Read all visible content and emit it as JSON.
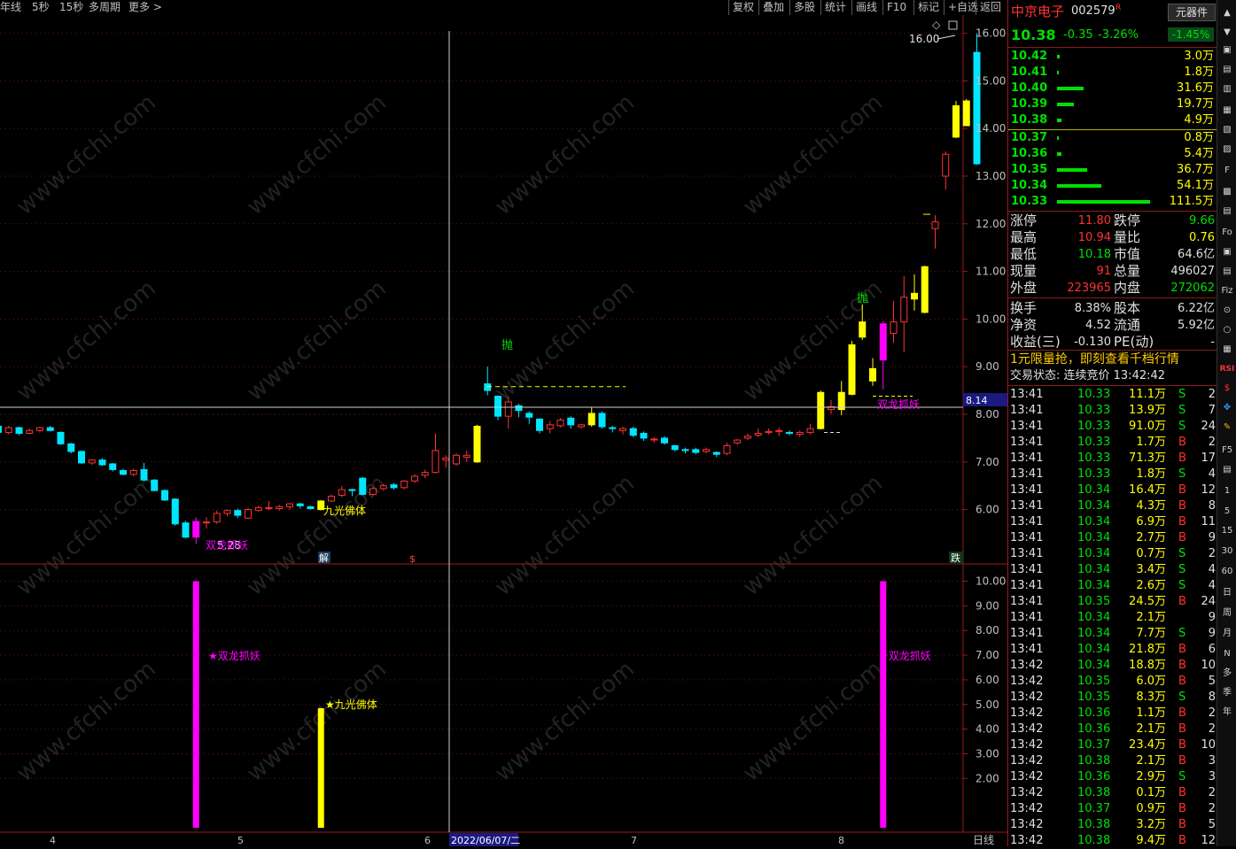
{
  "toolbar": {
    "left": [
      "年线",
      "5秒",
      "15秒",
      "多周期",
      "更多 >"
    ],
    "right": [
      "复权",
      "叠加",
      "多股",
      "统计",
      "画线",
      "F10",
      "标记",
      "+自选",
      "返回"
    ]
  },
  "watermark": "www.cfchi.com",
  "main_chart": {
    "y_ticks": [
      "16.00",
      "15.00",
      "14.00",
      "13.00",
      "12.00",
      "11.00",
      "10.00",
      "9.00",
      "8.00",
      "7.00",
      "6.00"
    ],
    "max_label": "16.00",
    "cursor_price": "8.14",
    "min_label": "5.28",
    "labels": {
      "sell_1": "抛",
      "sell_2": "抛",
      "double_dragon_1": "双龙抓妖",
      "double_dragon_2": "双龙抓妖",
      "nine_light": "九光佛体",
      "jie": "解",
      "s_mark": "$",
      "die": "跌"
    }
  },
  "sub_chart": {
    "y_ticks": [
      "10.00",
      "9.00",
      "8.00",
      "7.00",
      "6.00",
      "5.00",
      "4.00",
      "3.00",
      "2.00"
    ],
    "labels": {
      "double_dragon_1": "★双龙抓妖",
      "double_dragon_2": "★双龙抓妖",
      "nine_light": "★九光佛体"
    }
  },
  "date_axis": {
    "ticks": [
      "4",
      "5",
      "6",
      "7",
      "8"
    ],
    "cursor_date": "2022/06/07/二",
    "period": "日线"
  },
  "colors": {
    "up": "#ff3232",
    "down": "#00e5ff",
    "yellow": "#ffff00",
    "magenta": "#ff00ff",
    "green": "#00e000"
  },
  "quote": {
    "name": "中京电子",
    "code": "002579",
    "r_mark": "R",
    "sector": "元器件",
    "sector_change": "-1.45%",
    "price": "10.38",
    "change": "-0.35",
    "change_pct": "-3.26%",
    "asks": [
      {
        "price": "10.42",
        "vol": "3.0万",
        "bar": 3
      },
      {
        "price": "10.41",
        "vol": "1.8万",
        "bar": 2
      },
      {
        "price": "10.40",
        "vol": "31.6万",
        "bar": 30
      },
      {
        "price": "10.39",
        "vol": "19.7万",
        "bar": 19
      },
      {
        "price": "10.38",
        "vol": "4.9万",
        "bar": 5
      }
    ],
    "bids": [
      {
        "price": "10.37",
        "vol": "0.8万",
        "bar": 2
      },
      {
        "price": "10.36",
        "vol": "5.4万",
        "bar": 5
      },
      {
        "price": "10.35",
        "vol": "36.7万",
        "bar": 34
      },
      {
        "price": "10.34",
        "vol": "54.1万",
        "bar": 50
      },
      {
        "price": "10.33",
        "vol": "111.5万",
        "bar": 105
      }
    ],
    "stats": [
      {
        "l1": "涨停",
        "v1": "11.80",
        "c1": "#ff3232",
        "l2": "跌停",
        "v2": "9.66",
        "c2": "#00e000"
      },
      {
        "l1": "最高",
        "v1": "10.94",
        "c1": "#ff3232",
        "l2": "量比",
        "v2": "0.76",
        "c2": "#ffff00"
      },
      {
        "l1": "最低",
        "v1": "10.18",
        "c1": "#00e000",
        "l2": "市值",
        "v2": "64.6亿",
        "c2": "#e0e0e0"
      },
      {
        "l1": "现量",
        "v1": "91",
        "c1": "#ff3232",
        "l2": "总量",
        "v2": "496027",
        "c2": "#e0e0e0"
      },
      {
        "l1": "外盘",
        "v1": "223965",
        "c1": "#ff3232",
        "l2": "内盘",
        "v2": "272062",
        "c2": "#00e000"
      },
      {
        "l1": "换手",
        "v1": "8.38%",
        "c1": "#e0e0e0",
        "l2": "股本",
        "v2": "6.22亿",
        "c2": "#e0e0e0"
      },
      {
        "l1": "净资",
        "v1": "4.52",
        "c1": "#e0e0e0",
        "l2": "流通",
        "v2": "5.92亿",
        "c2": "#e0e0e0"
      },
      {
        "l1": "收益(三)",
        "v1": "-0.130",
        "c1": "#e0e0e0",
        "l2": "PE(动)",
        "v2": "-",
        "c2": "#e0e0e0"
      }
    ],
    "ad": "1元限量抢，即刻查看千档行情",
    "status": "交易状态: 连续竞价 13:42:42",
    "ticks": [
      {
        "t": "13:41",
        "p": "10.33",
        "v": "11.1万",
        "d": "S",
        "n": "2"
      },
      {
        "t": "13:41",
        "p": "10.33",
        "v": "13.9万",
        "d": "S",
        "n": "7"
      },
      {
        "t": "13:41",
        "p": "10.33",
        "v": "91.0万",
        "d": "S",
        "n": "24"
      },
      {
        "t": "13:41",
        "p": "10.33",
        "v": "1.7万",
        "d": "B",
        "n": "2"
      },
      {
        "t": "13:41",
        "p": "10.33",
        "v": "71.3万",
        "d": "B",
        "n": "17"
      },
      {
        "t": "13:41",
        "p": "10.33",
        "v": "1.8万",
        "d": "S",
        "n": "4"
      },
      {
        "t": "13:41",
        "p": "10.34",
        "v": "16.4万",
        "d": "B",
        "n": "12"
      },
      {
        "t": "13:41",
        "p": "10.34",
        "v": "4.3万",
        "d": "B",
        "n": "8"
      },
      {
        "t": "13:41",
        "p": "10.34",
        "v": "6.9万",
        "d": "B",
        "n": "11"
      },
      {
        "t": "13:41",
        "p": "10.34",
        "v": "2.7万",
        "d": "B",
        "n": "9"
      },
      {
        "t": "13:41",
        "p": "10.34",
        "v": "0.7万",
        "d": "S",
        "n": "2"
      },
      {
        "t": "13:41",
        "p": "10.34",
        "v": "3.4万",
        "d": "S",
        "n": "4"
      },
      {
        "t": "13:41",
        "p": "10.34",
        "v": "2.6万",
        "d": "S",
        "n": "4"
      },
      {
        "t": "13:41",
        "p": "10.35",
        "v": "24.5万",
        "d": "B",
        "n": "24"
      },
      {
        "t": "13:41",
        "p": "10.34",
        "v": "2.1万",
        "d": "",
        "n": "9"
      },
      {
        "t": "13:41",
        "p": "10.34",
        "v": "7.7万",
        "d": "S",
        "n": "9"
      },
      {
        "t": "13:41",
        "p": "10.34",
        "v": "21.8万",
        "d": "B",
        "n": "6"
      },
      {
        "t": "13:42",
        "p": "10.34",
        "v": "18.8万",
        "d": "B",
        "n": "10"
      },
      {
        "t": "13:42",
        "p": "10.35",
        "v": "6.0万",
        "d": "B",
        "n": "5"
      },
      {
        "t": "13:42",
        "p": "10.35",
        "v": "8.3万",
        "d": "S",
        "n": "8"
      },
      {
        "t": "13:42",
        "p": "10.36",
        "v": "1.1万",
        "d": "B",
        "n": "2"
      },
      {
        "t": "13:42",
        "p": "10.36",
        "v": "2.1万",
        "d": "B",
        "n": "2"
      },
      {
        "t": "13:42",
        "p": "10.37",
        "v": "23.4万",
        "d": "B",
        "n": "10"
      },
      {
        "t": "13:42",
        "p": "10.38",
        "v": "2.1万",
        "d": "B",
        "n": "3"
      },
      {
        "t": "13:42",
        "p": "10.36",
        "v": "2.9万",
        "d": "S",
        "n": "3"
      },
      {
        "t": "13:42",
        "p": "10.38",
        "v": "0.1万",
        "d": "B",
        "n": "2"
      },
      {
        "t": "13:42",
        "p": "10.37",
        "v": "0.9万",
        "d": "B",
        "n": "2"
      },
      {
        "t": "13:42",
        "p": "10.38",
        "v": "3.2万",
        "d": "B",
        "n": "5"
      },
      {
        "t": "13:42",
        "p": "10.38",
        "v": "9.4万",
        "d": "B",
        "n": "12"
      }
    ]
  },
  "icon_bar": [
    "▲",
    "▼",
    "▣",
    "▤",
    "▥",
    "▦",
    "▧",
    "▨",
    "F",
    "▩",
    "▤",
    "Fo",
    "▣",
    "▤",
    "Fiz",
    "⊙",
    "○",
    "▦",
    "RSI",
    "$",
    "✥",
    "✎",
    "F5",
    "▤",
    "1",
    "5",
    "15",
    "30",
    "60",
    "日",
    "周",
    "月",
    "N",
    "多",
    "季",
    "年"
  ],
  "candles": [
    [
      0,
      7.75,
      7.62,
      7.78,
      7.58
    ],
    [
      1,
      7.62,
      7.72,
      7.76,
      7.58
    ],
    [
      2,
      7.72,
      7.6,
      7.74,
      7.56
    ],
    [
      3,
      7.6,
      7.66,
      7.7,
      7.58
    ],
    [
      4,
      7.66,
      7.72,
      7.74,
      7.62
    ],
    [
      5,
      7.72,
      7.66,
      7.76,
      7.64
    ],
    [
      6,
      7.62,
      7.38,
      7.64,
      7.36
    ],
    [
      7,
      7.38,
      7.22,
      7.4,
      7.18
    ],
    [
      8,
      7.22,
      6.98,
      7.24,
      6.96
    ],
    [
      9,
      6.98,
      7.04,
      7.06,
      6.94
    ],
    [
      10,
      7.04,
      6.94,
      7.08,
      6.92
    ],
    [
      11,
      6.96,
      6.84,
      6.98,
      6.8
    ],
    [
      12,
      6.82,
      6.74,
      6.86,
      6.72
    ],
    [
      13,
      6.74,
      6.82,
      6.86,
      6.7
    ],
    [
      14,
      6.84,
      6.62,
      6.98,
      6.6
    ],
    [
      15,
      6.62,
      6.4,
      6.64,
      6.38
    ],
    [
      16,
      6.4,
      6.2,
      6.42,
      6.18
    ],
    [
      17,
      6.22,
      5.7,
      6.24,
      5.66
    ],
    [
      18,
      5.72,
      5.42,
      5.76,
      5.4
    ],
    [
      19,
      5.42,
      5.75,
      5.84,
      5.28
    ],
    [
      20,
      5.72,
      5.74,
      5.84,
      5.6
    ],
    [
      21,
      5.74,
      5.92,
      5.98,
      5.7
    ],
    [
      22,
      5.92,
      5.98,
      6.0,
      5.86
    ],
    [
      23,
      5.98,
      5.88,
      6.02,
      5.82
    ],
    [
      24,
      5.82,
      6.0,
      6.04,
      5.8
    ],
    [
      25,
      5.98,
      6.04,
      6.08,
      5.96
    ],
    [
      26,
      6.02,
      6.04,
      6.18,
      5.98
    ],
    [
      27,
      6.02,
      6.06,
      6.1,
      5.98
    ],
    [
      28,
      6.06,
      6.12,
      6.14,
      6.0
    ],
    [
      29,
      6.12,
      6.08,
      6.14,
      6.02
    ],
    [
      30,
      6.06,
      6.02,
      6.08,
      6.0
    ],
    [
      31,
      6.0,
      6.18,
      6.2,
      5.98
    ],
    [
      32,
      6.18,
      6.28,
      6.32,
      6.16
    ],
    [
      33,
      6.3,
      6.42,
      6.5,
      6.26
    ],
    [
      34,
      6.42,
      6.4,
      6.44,
      6.28
    ],
    [
      35,
      6.66,
      6.32,
      6.68,
      6.3
    ],
    [
      36,
      6.32,
      6.44,
      6.48,
      6.28
    ],
    [
      37,
      6.44,
      6.5,
      6.54,
      6.4
    ],
    [
      38,
      6.52,
      6.46,
      6.56,
      6.42
    ],
    [
      39,
      6.46,
      6.6,
      6.62,
      6.42
    ],
    [
      40,
      6.6,
      6.7,
      6.74,
      6.56
    ],
    [
      41,
      6.72,
      6.78,
      6.84,
      6.66
    ],
    [
      42,
      6.78,
      7.24,
      7.6,
      6.76
    ],
    [
      43,
      7.04,
      7.08,
      7.14,
      6.88
    ],
    [
      44,
      6.96,
      7.14,
      7.18,
      6.92
    ],
    [
      45,
      7.1,
      7.14,
      7.24,
      7.0
    ],
    [
      46,
      7.0,
      7.75,
      7.78,
      6.98
    ],
    [
      47,
      8.5,
      8.64,
      9.0,
      8.4
    ],
    [
      48,
      8.38,
      7.96,
      8.4,
      7.88
    ],
    [
      49,
      7.96,
      8.26,
      8.38,
      7.7
    ],
    [
      50,
      8.18,
      8.08,
      8.22,
      7.94
    ],
    [
      51,
      8.02,
      7.94,
      8.06,
      7.8
    ],
    [
      52,
      7.9,
      7.66,
      7.92,
      7.6
    ],
    [
      53,
      7.7,
      7.78,
      7.86,
      7.6
    ],
    [
      54,
      7.76,
      7.88,
      7.92,
      7.72
    ],
    [
      55,
      7.92,
      7.78,
      7.96,
      7.7
    ],
    [
      56,
      7.74,
      7.78,
      7.8,
      7.7
    ],
    [
      57,
      7.78,
      8.02,
      8.16,
      7.74
    ],
    [
      58,
      8.02,
      7.74,
      8.06,
      7.7
    ],
    [
      59,
      7.72,
      7.7,
      7.76,
      7.62
    ],
    [
      60,
      7.66,
      7.7,
      7.74,
      7.58
    ],
    [
      61,
      7.7,
      7.56,
      7.74,
      7.52
    ],
    [
      62,
      7.6,
      7.5,
      7.64,
      7.44
    ],
    [
      63,
      7.48,
      7.48,
      7.52,
      7.4
    ],
    [
      64,
      7.5,
      7.4,
      7.54,
      7.36
    ],
    [
      65,
      7.34,
      7.26,
      7.36,
      7.22
    ],
    [
      66,
      7.26,
      7.24,
      7.3,
      7.18
    ],
    [
      67,
      7.26,
      7.2,
      7.3,
      7.16
    ],
    [
      68,
      7.22,
      7.26,
      7.3,
      7.18
    ],
    [
      69,
      7.2,
      7.16,
      7.22,
      7.1
    ],
    [
      70,
      7.18,
      7.34,
      7.4,
      7.14
    ],
    [
      71,
      7.4,
      7.46,
      7.48,
      7.36
    ],
    [
      72,
      7.5,
      7.54,
      7.6,
      7.46
    ],
    [
      73,
      7.56,
      7.6,
      7.7,
      7.52
    ],
    [
      74,
      7.62,
      7.64,
      7.7,
      7.58
    ],
    [
      75,
      7.64,
      7.66,
      7.72,
      7.54
    ],
    [
      76,
      7.62,
      7.6,
      7.66,
      7.56
    ],
    [
      77,
      7.58,
      7.62,
      7.66,
      7.52
    ],
    [
      78,
      7.62,
      7.7,
      7.8,
      7.58
    ],
    [
      79,
      7.7,
      8.46,
      8.5,
      7.68
    ],
    [
      80,
      8.1,
      8.16,
      8.3,
      8.0
    ],
    [
      81,
      8.1,
      8.46,
      8.7,
      7.98
    ],
    [
      82,
      8.42,
      9.46,
      9.54,
      8.4
    ],
    [
      83,
      9.62,
      9.94,
      10.3,
      9.56
    ],
    [
      84,
      8.7,
      8.96,
      9.18,
      8.6
    ],
    [
      85,
      9.14,
      9.9,
      9.96,
      8.52
    ],
    [
      86,
      9.7,
      9.94,
      10.38,
      9.5
    ],
    [
      87,
      9.94,
      10.46,
      10.9,
      9.3
    ],
    [
      88,
      10.42,
      10.54,
      10.94,
      10.18
    ],
    [
      89,
      10.14,
      11.1,
      11.12,
      10.12
    ],
    [
      90,
      11.9,
      12.04,
      12.18,
      11.48
    ],
    [
      91,
      13.0,
      13.46,
      13.52,
      12.72
    ],
    [
      92,
      13.82,
      14.48,
      14.58,
      13.8
    ],
    [
      93,
      14.06,
      14.58,
      14.62,
      14.14
    ],
    [
      94,
      13.26,
      15.6,
      16.0,
      13.24
    ]
  ],
  "candle_tags": {
    "y": [
      19,
      31,
      46,
      57,
      79,
      81,
      82,
      83,
      84,
      85,
      88,
      89,
      92,
      93
    ],
    "c": [
      17,
      18,
      47,
      48,
      52,
      57,
      83,
      84,
      94
    ],
    "m": [
      19,
      85
    ]
  },
  "signal_bars": [
    {
      "x": 19,
      "v": 10,
      "c": "m"
    },
    {
      "x": 31,
      "v": 4.85,
      "c": "y"
    },
    {
      "x": 85,
      "v": 10,
      "c": "m"
    }
  ]
}
